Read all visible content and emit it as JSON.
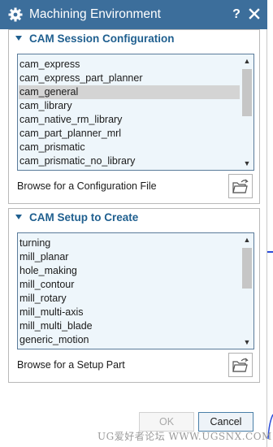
{
  "window": {
    "title": "Machining Environment",
    "help_label": "?",
    "accent": "#3c6e9b"
  },
  "session_config": {
    "header": "CAM Session Configuration",
    "items": [
      "cam_express",
      "cam_express_part_planner",
      "cam_general",
      "cam_library",
      "cam_native_rm_library",
      "cam_part_planner_mrl",
      "cam_prismatic",
      "cam_prismatic_no_library"
    ],
    "selected": "cam_general",
    "browse_label": "Browse for a Configuration File"
  },
  "setup": {
    "header": "CAM Setup to Create",
    "items": [
      "turning",
      "mill_planar",
      "hole_making",
      "mill_contour",
      "mill_rotary",
      "mill_multi-axis",
      "mill_multi_blade",
      "generic_motion"
    ],
    "browse_label": "Browse for a Setup Part"
  },
  "footer": {
    "ok_label": "OK",
    "cancel_label": "Cancel"
  },
  "watermark": "UG爱好者论坛 WWW.UGSNX.COM"
}
